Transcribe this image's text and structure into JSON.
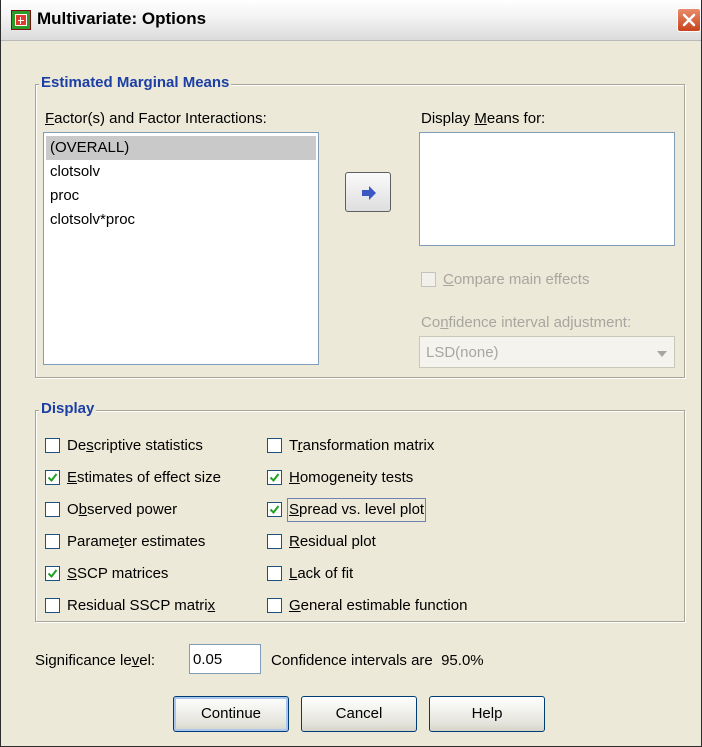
{
  "window": {
    "title": "Multivariate: Options",
    "icons": {
      "app": "spss-grid-icon",
      "close": "close-x-icon"
    }
  },
  "emm": {
    "legend": "Estimated Marginal Means",
    "factors_label": {
      "pre": "",
      "u": "F",
      "post": "actor(s) and Factor Interactions:"
    },
    "factors": [
      "(OVERALL)",
      "clotsolv",
      "proc",
      "clotsolv*proc"
    ],
    "selected_factor": "(OVERALL)",
    "move_button_icon": "right-arrow-icon",
    "display_means_label": {
      "pre": "Display ",
      "u": "M",
      "post": "eans for:"
    },
    "compare_main_effects": {
      "pre": "",
      "u": "C",
      "post": "ompare main effects",
      "checked": false,
      "enabled": false
    },
    "ci_adjustment_label": {
      "pre": "Co",
      "u": "n",
      "post": "fidence interval adjustment:"
    },
    "ci_adjustment_value": "LSD(none)"
  },
  "display": {
    "legend": "Display",
    "left": [
      {
        "pre": "De",
        "u": "s",
        "post": "criptive statistics",
        "checked": false
      },
      {
        "pre": "",
        "u": "E",
        "post": "stimates of effect size",
        "checked": true
      },
      {
        "pre": "O",
        "u": "b",
        "post": "served power",
        "checked": false
      },
      {
        "pre": "Parame",
        "u": "t",
        "post": "er estimates",
        "checked": false
      },
      {
        "pre": "",
        "u": "S",
        "post": "SCP matrices",
        "checked": true
      },
      {
        "pre": "Residual SSCP matri",
        "u": "x",
        "post": "",
        "checked": false
      }
    ],
    "right": [
      {
        "pre": "T",
        "u": "r",
        "post": "ansformation matrix",
        "checked": false
      },
      {
        "pre": "",
        "u": "H",
        "post": "omogeneity tests",
        "checked": true
      },
      {
        "pre": "",
        "u": "S",
        "post": "pread vs. level plot",
        "checked": true
      },
      {
        "pre": "",
        "u": "R",
        "post": "esidual plot",
        "checked": false
      },
      {
        "pre": "",
        "u": "L",
        "post": "ack of fit",
        "checked": false
      },
      {
        "pre": "",
        "u": "G",
        "post": "eneral estimable function",
        "checked": false
      }
    ]
  },
  "significance": {
    "label": {
      "pre": "Significance le",
      "u": "v",
      "post": "el:"
    },
    "value": "0.05",
    "ci_text": "Confidence intervals are  95.0%"
  },
  "buttons": {
    "continue": "Continue",
    "cancel": "Cancel",
    "help": "Help"
  }
}
